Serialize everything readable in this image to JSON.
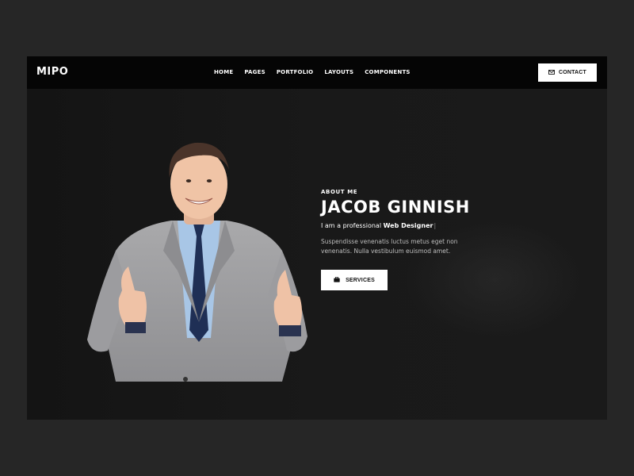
{
  "header": {
    "logo": "MIPO",
    "nav": [
      "HOME",
      "PAGES",
      "PORTFOLIO",
      "LAYOUTS",
      "COMPONENTS"
    ],
    "contact_label": "CONTACT",
    "contact_icon": "envelope-icon"
  },
  "hero": {
    "eyebrow": "ABOUT ME",
    "name": "JACOB GINNISH",
    "role_prefix": "I am a professional ",
    "role_highlight": "Web Designer",
    "description": "Suspendisse venenatis luctus metus eget non venenatis. Nulla vestibulum euismod amet.",
    "services_label": "SERVICES",
    "services_icon": "briefcase-icon"
  },
  "colors": {
    "page_background": "#262626",
    "header_background": "#050505",
    "hero_background": "#161616",
    "button_background": "#ffffff",
    "text_primary": "#ffffff",
    "text_muted": "#bdbdbd"
  }
}
